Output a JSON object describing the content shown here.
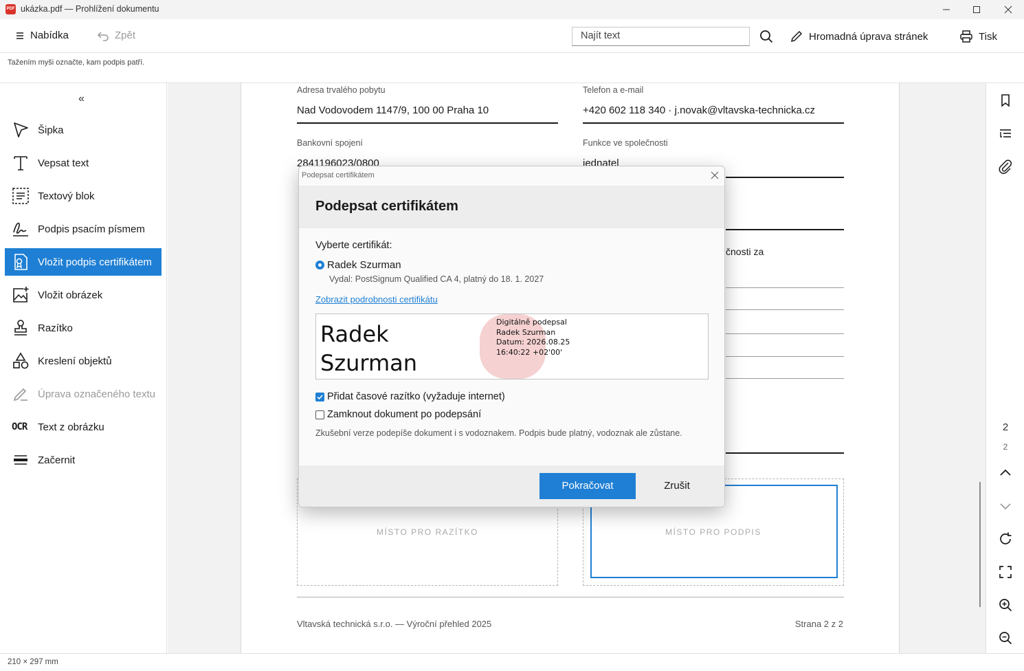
{
  "window": {
    "title": "ukázka.pdf — Prohlížení dokumentu",
    "app_icon_text": "PDF"
  },
  "toolbar": {
    "menu_label": "Nabídka",
    "back_label": "Zpět",
    "search_placeholder": "Najít text",
    "bulk_edit_label": "Hromadná úprava stránek",
    "print_label": "Tisk"
  },
  "hint": "Tažením myši označte, kam podpis patří.",
  "sidebar": {
    "collapse_glyph": "«",
    "tools": [
      {
        "label": "Šipka",
        "icon": "arrow-pointer-icon",
        "state": "normal"
      },
      {
        "label": "Vepsat text",
        "icon": "text-cursor-icon",
        "state": "normal"
      },
      {
        "label": "Textový blok",
        "icon": "text-block-icon",
        "state": "normal"
      },
      {
        "label": "Podpis psacím písmem",
        "icon": "handwritten-signature-icon",
        "state": "normal"
      },
      {
        "label": "Vložit podpis certifikátem",
        "icon": "certificate-signature-icon",
        "state": "active"
      },
      {
        "label": "Vložit obrázek",
        "icon": "insert-image-icon",
        "state": "normal"
      },
      {
        "label": "Razítko",
        "icon": "stamp-icon",
        "state": "normal"
      },
      {
        "label": "Kreslení objektů",
        "icon": "shapes-icon",
        "state": "normal"
      },
      {
        "label": "Úprava označeného textu",
        "icon": "edit-selected-text-icon",
        "state": "disabled"
      },
      {
        "label": "Text z obrázku",
        "icon": "ocr-icon",
        "state": "normal",
        "glyph": "OCR"
      },
      {
        "label": "Začernit",
        "icon": "redact-icon",
        "state": "normal"
      }
    ]
  },
  "document": {
    "fields": [
      {
        "label": "Adresa trvalého pobytu",
        "value": "Nad Vodovodem 1147/9, 100 00 Praha 10"
      },
      {
        "label": "Telefon a e-mail",
        "value": "+420 602 118 340 · j.novak@vltavska-technicka.cz"
      },
      {
        "label": "Bankovní spojení",
        "value": "2841196023/0800"
      },
      {
        "label": "Funkce ve společnosti",
        "value": "jednatel"
      }
    ],
    "partial_text": "čnosti za",
    "stamp_box_label": "MÍSTO PRO RAZÍTKO",
    "signature_box_label": "MÍSTO PRO PODPIS",
    "footer_left": "Vltavská technická s.r.o. — Výroční přehled 2025",
    "footer_right": "Strana 2 z 2"
  },
  "rightbar": {
    "current_page": "2",
    "total_pages": "2"
  },
  "status": {
    "page_size": "210 × 297 mm"
  },
  "dialog": {
    "window_title": "Podepsat certifikátem",
    "heading": "Podepsat certifikátem",
    "choose_label": "Vyberte certifikát:",
    "certificate_name": "Radek Szurman",
    "certificate_issuer": "Vydal: PostSignum Qualified CA 4, platný do 18. 1. 2027",
    "details_link": "Zobrazit podrobnosti certifikátu",
    "preview": {
      "name_line1": "Radek",
      "name_line2": "Szurman",
      "stamp_lines": [
        "Digitálně podepsal",
        "Radek Szurman",
        "Datum: 2026.08.25",
        "16:40:22 +02'00'"
      ]
    },
    "timestamp_option": {
      "label": "Přidat časové razítko (vyžaduje internet)",
      "checked": true
    },
    "lock_option": {
      "label": "Zamknout dokument po podepsání",
      "checked": false
    },
    "trial_note": "Zkušební verze podepíše dokument i s vodoznakem. Podpis bude platný, vodoznak ale zůstane.",
    "continue_label": "Pokračovat",
    "cancel_label": "Zrušit"
  },
  "colors": {
    "accent": "#1f7fd4",
    "stamp_blob": "#f3c9c9",
    "pdf_icon": "#d9342b"
  }
}
